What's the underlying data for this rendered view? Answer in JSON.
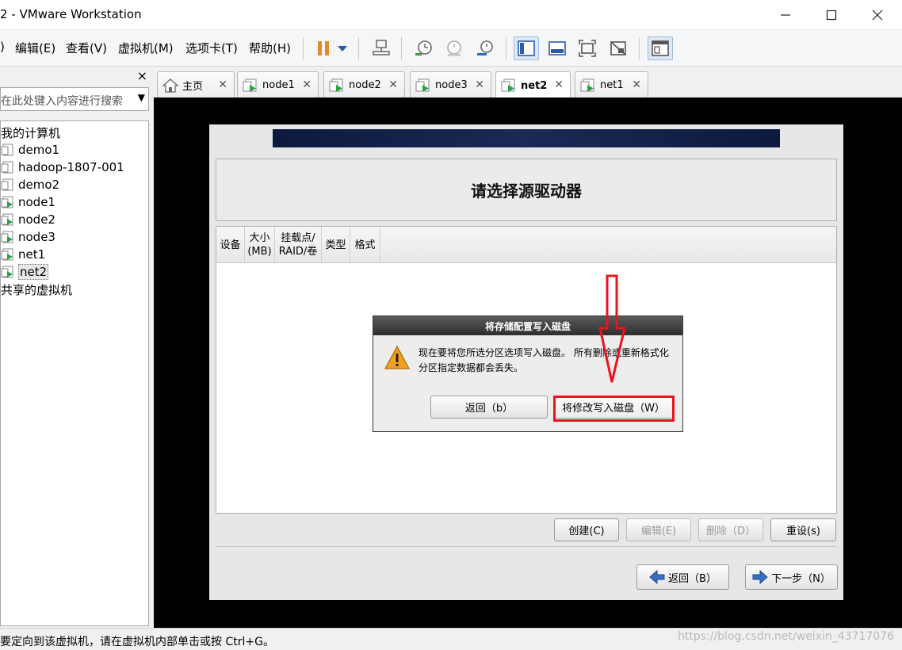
{
  "window": {
    "title": "2 - VMware Workstation",
    "controls": [
      "minimize",
      "maximize",
      "close"
    ]
  },
  "menu": {
    "items": [
      {
        "label": ")"
      },
      {
        "label": "编辑(E)"
      },
      {
        "label": "查看(V)"
      },
      {
        "label": "虚拟机(M)"
      },
      {
        "label": "选项卡(T)"
      },
      {
        "label": "帮助(H)"
      }
    ]
  },
  "toolbar": {
    "icons": [
      "pause-icon",
      "dropdown-icon",
      "network-icon",
      "snapshot-take-icon",
      "snapshot-revert-icon",
      "snapshot-manager-icon",
      "console-view-icon",
      "fullscreen-bar-icon",
      "fullscreen-icon",
      "unity-icon",
      "library-icon"
    ]
  },
  "sidebar": {
    "close": "×",
    "search_placeholder": "在此处键入内容进行搜索",
    "tree": [
      {
        "label": "我的计算机",
        "type": "group"
      },
      {
        "label": "demo1",
        "type": "vm",
        "running": false
      },
      {
        "label": "hadoop-1807-001",
        "type": "vm",
        "running": false
      },
      {
        "label": "demo2",
        "type": "vm",
        "running": false
      },
      {
        "label": "node1",
        "type": "vm",
        "running": true
      },
      {
        "label": "node2",
        "type": "vm",
        "running": true
      },
      {
        "label": "node3",
        "type": "vm",
        "running": true
      },
      {
        "label": "net1",
        "type": "vm",
        "running": true
      },
      {
        "label": "net2",
        "type": "vm",
        "running": true,
        "selected": true
      },
      {
        "label": "共享的虚拟机",
        "type": "group"
      }
    ]
  },
  "tabs": [
    {
      "label": "主页",
      "icon": "home-icon",
      "active": false
    },
    {
      "label": "node1",
      "icon": "vm-running-icon",
      "active": false
    },
    {
      "label": "node2",
      "icon": "vm-running-icon",
      "active": false
    },
    {
      "label": "node3",
      "icon": "vm-running-icon",
      "active": false
    },
    {
      "label": "net2",
      "icon": "vm-running-icon",
      "active": true
    },
    {
      "label": "net1",
      "icon": "vm-running-icon",
      "active": false
    }
  ],
  "installer": {
    "heading": "请选择源驱动器",
    "columns": [
      "设备",
      "大小\n(MB)",
      "挂载点/\nRAID/卷",
      "类型",
      "格式"
    ],
    "buttons": {
      "create": "创建(C)",
      "edit": "编辑(E)",
      "delete": "删除（D）",
      "reset": "重设(s)",
      "back": "返回（B）",
      "next": "下一步（N）"
    }
  },
  "dialog": {
    "title": "将存储配置写入磁盘",
    "message": "现在要将您所选分区选项写入磁盘。 所有删除或重新格式化分区指定数据都会丢失。",
    "back_label": "返回（b）",
    "write_label": "将修改写入磁盘（W）"
  },
  "annotation_color": "#e8141f",
  "statusbar": {
    "message": "要定向到该虚拟机，请在虚拟机内部单击或按 Ctrl+G。",
    "watermark": "https://blog.csdn.net/weixin_43717076"
  }
}
